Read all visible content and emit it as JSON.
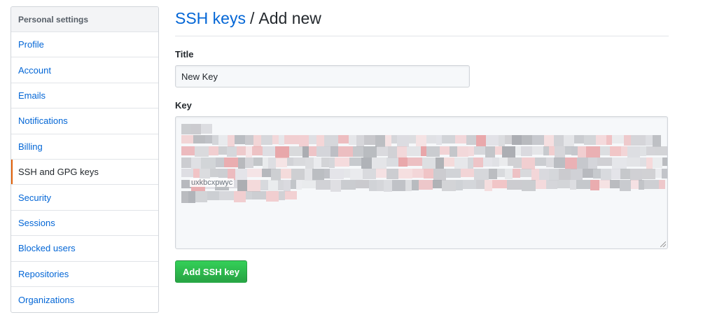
{
  "sidebar": {
    "header": "Personal settings",
    "items": [
      {
        "label": "Profile"
      },
      {
        "label": "Account"
      },
      {
        "label": "Emails"
      },
      {
        "label": "Notifications"
      },
      {
        "label": "Billing"
      },
      {
        "label": "SSH and GPG keys",
        "selected": true
      },
      {
        "label": "Security"
      },
      {
        "label": "Sessions"
      },
      {
        "label": "Blocked users"
      },
      {
        "label": "Repositories"
      },
      {
        "label": "Organizations"
      }
    ]
  },
  "header": {
    "breadcrumb_link": "SSH keys",
    "separator": "/",
    "current": "Add new"
  },
  "form": {
    "title_label": "Title",
    "title_value": "New Key",
    "key_label": "Key",
    "key_visible_fragment": "uxkbcxpwyc",
    "submit_label": "Add SSH key"
  },
  "colors": {
    "link": "#0366d6",
    "selected_indicator": "#e36209",
    "button_green": "#28a745"
  }
}
